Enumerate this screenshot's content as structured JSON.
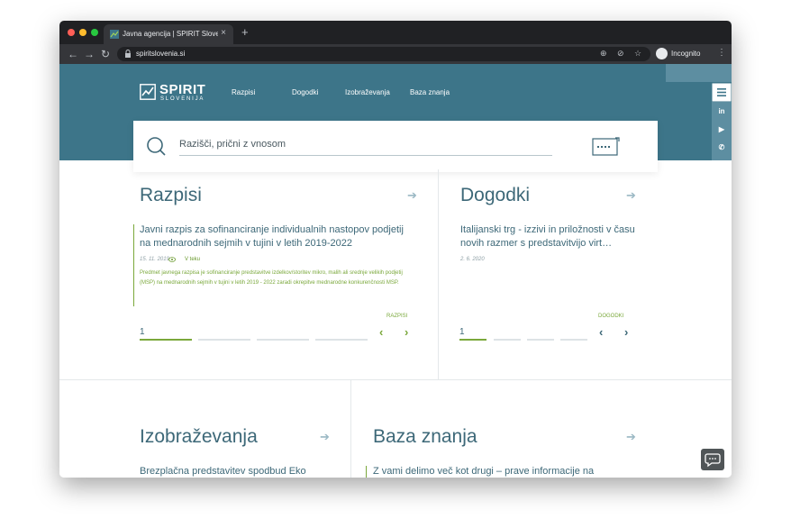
{
  "browser": {
    "tab_title": "Javna agencija | SPIRIT Slovenija",
    "tab_close": "×",
    "new_tab": "+",
    "url": "spiritslovenia.si",
    "incognito_label": "Incognito"
  },
  "site": {
    "logo_name": "SPIRIT",
    "logo_sub": "SLOVENIJA",
    "nav": [
      "Razpisi",
      "Dogodki",
      "Izobraževanja",
      "Baza znanja"
    ]
  },
  "search": {
    "placeholder": "Razišči, prični z vnosom"
  },
  "razpisi": {
    "heading": "Razpisi",
    "item_title": "Javni razpis za sofinanciranje individualnih nastopov podjetij na mednarodnih sejmih v tujini v letih 2019-2022",
    "date": "15. 11. 2019",
    "status": "V teku",
    "description": "Predmet javnega razpisa je sofinanciranje predstavitve izdelkov/storitev mikro, malih ali srednje velikih podjetij (MSP) na mednarodnih sejmih v tujini v letih 2019 - 2022 zaradi okrepitve mednarodne konkurenčnosti MSP.",
    "tag": "RAZPISI",
    "page": "1"
  },
  "dogodki": {
    "heading": "Dogodki",
    "item_title": "Italijanski trg - izzivi in priložnosti v času novih razmer s predstavitvijo virt…",
    "date": "2. 6. 2020",
    "tag": "DOGODKI",
    "page": "1"
  },
  "izobrazevanja": {
    "heading": "Izobraževanja",
    "item_title": "Brezplačna predstavitev spodbud Eko"
  },
  "baza_znanja": {
    "heading": "Baza znanja",
    "item_title": "Z vami delimo več kot drugi – prave informacije na"
  },
  "colors": {
    "teal": "#3d7589",
    "heading": "#3d6878",
    "green": "#7aa83b"
  }
}
